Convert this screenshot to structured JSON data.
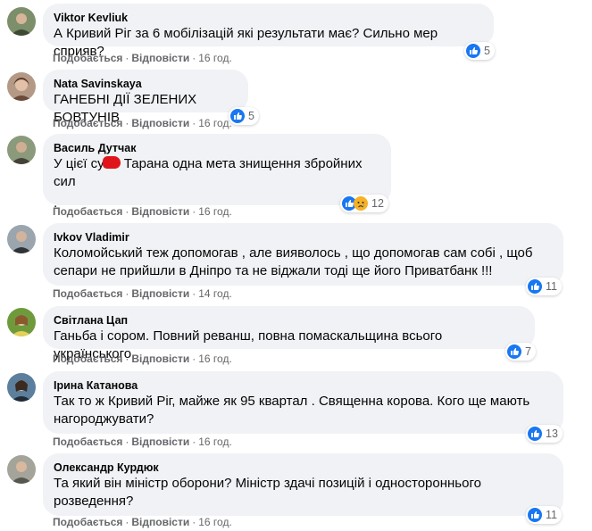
{
  "actions": {
    "like": "Подобається",
    "reply": "Відповісти",
    "dot": "·"
  },
  "colors": {
    "like_blue": "#1877f2",
    "sad_yellow": "#f7b125",
    "redaction": "#e0151c"
  },
  "comments": [
    {
      "author": "Viktor Kevliuk",
      "text": "А Кривий Ріг за 6 мобілізацій які результати має? Сильно мер сприяв?",
      "time": "16 год.",
      "reactions": [
        "like-icon"
      ],
      "count": "5"
    },
    {
      "author": "Nata Savinskaya",
      "text": "ГАНЕБНІ ДІЇ ЗЕЛЕНИХ БОВТУНІВ",
      "time": "16 год.",
      "reactions": [
        "like-icon"
      ],
      "count": "5"
    },
    {
      "author": "Василь Дутчак",
      "text_before": "У цієї су",
      "text_after": " Тарана одна мета знищення збройних сил",
      "text_line2": ".",
      "time": "16 год.",
      "reactions": [
        "like-icon",
        "sad-icon"
      ],
      "count": "12"
    },
    {
      "author": "Ivkov Vladimir",
      "text": "Коломойський теж допомогав , але вияволось , що допомогав сам собі , щоб сепари не прийшли в Дніпро та не віджали тоді ще його Приватбанк !!!",
      "time": "14 год.",
      "reactions": [
        "like-icon"
      ],
      "count": "11"
    },
    {
      "author": "Світлана Цап",
      "text": "Ганьба і сором. Повний реванш, повна помаскальщина всього українського.",
      "time": "16 год.",
      "reactions": [
        "like-icon"
      ],
      "count": "7"
    },
    {
      "author": "Ірина Катанова",
      "text": "Так то ж Кривий Ріг, майже як 95 квартал . Священна корова. Кого ще мають нагороджувати?",
      "time": "16 год.",
      "reactions": [
        "like-icon"
      ],
      "count": "13"
    },
    {
      "author": "Олександр Курдюк",
      "text": "Та який він міністр оборони? Міністр здачі позицій і одностороннього розведення?",
      "time": "16 год.",
      "reactions": [
        "like-icon"
      ],
      "count": "11"
    }
  ]
}
